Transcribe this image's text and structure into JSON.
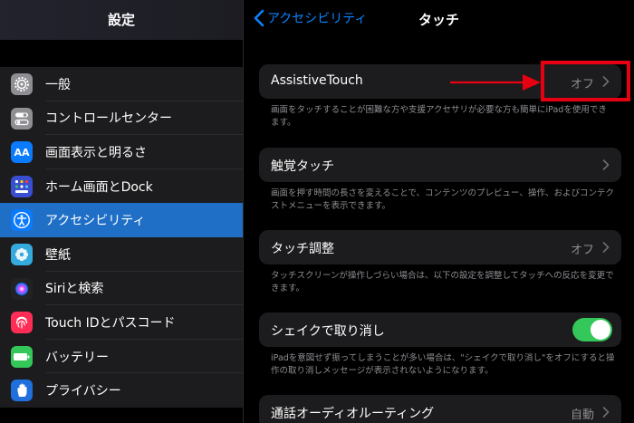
{
  "sidebar": {
    "title": "設定",
    "items": [
      {
        "label": "一般",
        "icon": "gear-icon",
        "color": "#8e8e93"
      },
      {
        "label": "コントロールセンター",
        "icon": "switches-icon",
        "color": "#8e8e93"
      },
      {
        "label": "画面表示と明るさ",
        "icon": "text-size-icon",
        "color": "#0a7aff",
        "glyph": "AA"
      },
      {
        "label": "ホーム画面とDock",
        "icon": "app-grid-icon",
        "color": "#3a4fd0"
      },
      {
        "label": "アクセシビリティ",
        "icon": "accessibility-icon",
        "color": "#0a7aff",
        "selected": true
      },
      {
        "label": "壁紙",
        "icon": "flower-icon",
        "color": "#35aadc"
      },
      {
        "label": "Siriと検索",
        "icon": "siri-icon",
        "color": "#222"
      },
      {
        "label": "Touch IDとパスコード",
        "icon": "fingerprint-icon",
        "color": "#ff2d55"
      },
      {
        "label": "バッテリー",
        "icon": "battery-icon",
        "color": "#34c759"
      },
      {
        "label": "プライバシー",
        "icon": "hand-icon",
        "color": "#1f6fdc"
      }
    ]
  },
  "nav": {
    "back_label": "アクセシビリティ",
    "title": "タッチ"
  },
  "settings": {
    "assistive_touch": {
      "label": "AssistiveTouch",
      "value": "オフ",
      "footnote": "画面をタッチすることが困難な方や支援アクセサリが必要な方も簡単にiPadを使用できます。"
    },
    "haptic_touch": {
      "label": "触覚タッチ",
      "footnote": "画面を押す時間の長さを変えることで、コンテンツのプレビュー、操作、およびコンテクストメニューを表示できます。"
    },
    "touch_accommodations": {
      "label": "タッチ調整",
      "value": "オフ",
      "footnote": "タッチスクリーンが操作しづらい場合は、以下の設定を調整してタッチへの反応を変更できます。"
    },
    "shake_to_undo": {
      "label": "シェイクで取り消し",
      "on": true,
      "footnote": "iPadを意図せず振ってしまうことが多い場合は、\"シェイクで取り消し\"をオフにすると操作の取り消しメッセージが表示されないようになります。"
    },
    "call_audio_routing": {
      "label": "通話オーディオルーティング",
      "value": "自動"
    }
  },
  "colors": {
    "accent": "#0a84ff",
    "selected_row": "#1f6fc7",
    "toggle_on": "#34c759",
    "annotation": "#e60012"
  }
}
